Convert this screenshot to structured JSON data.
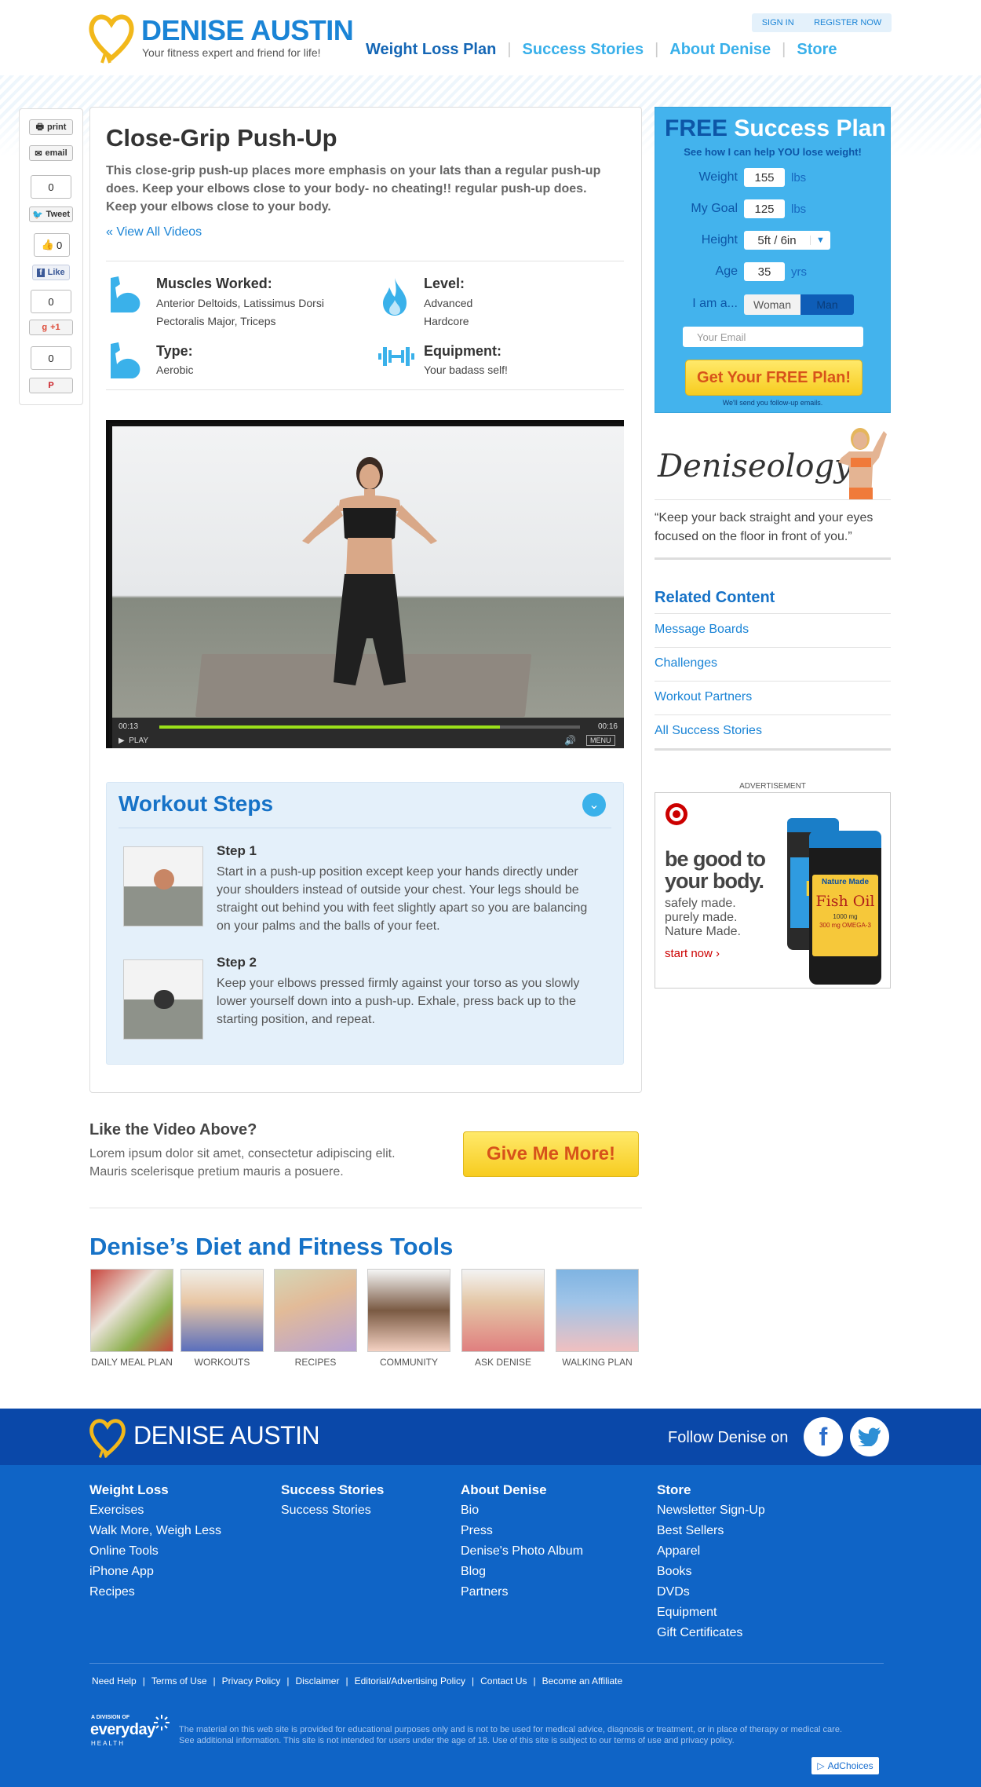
{
  "header": {
    "brand": "DENISE AUSTIN",
    "tagline": "Your fitness expert and friend for life!",
    "sign_in": "SIGN IN",
    "register": "REGISTER NOW",
    "nav": [
      "Weight Loss Plan",
      "Success Stories",
      "About Denise",
      "Store"
    ]
  },
  "share": {
    "print": "print",
    "email": "email",
    "tweet_count": "0",
    "tweet": "Tweet",
    "like_count": "0",
    "like": "Like",
    "gplus_count": "0",
    "gplus": "+1",
    "pin_count": "0"
  },
  "article": {
    "title": "Close-Grip Push-Up",
    "description": "This close-grip push-up places more emphasis on your lats than a regular push-up does. Keep your elbows close to your body- no cheating!!  regular push-up does. Keep your elbows close to your body.",
    "view_all": "« View All Videos",
    "muscles_label": "Muscles Worked:",
    "muscles_line1": "Anterior Deltoids, Latissimus Dorsi",
    "muscles_line2": "Pectoralis Major, Triceps",
    "level_label": "Level:",
    "level_line1": "Advanced",
    "level_line2": "Hardcore",
    "type_label": "Type:",
    "type_value": "Aerobic",
    "equipment_label": "Equipment:",
    "equipment_value": "Your badass self!"
  },
  "video": {
    "time_elapsed": "00:13",
    "time_total": "00:16",
    "progress": 0.81,
    "play": "PLAY",
    "menu": "MENU"
  },
  "steps": {
    "title": "Workout Steps",
    "items": [
      {
        "title": "Step 1",
        "text": "Start in a push-up position except keep your hands directly under your shoulders instead of outside your chest. Your legs should be straight out behind you with feet slightly apart so you are balancing on your palms and the balls of your feet."
      },
      {
        "title": "Step 2",
        "text": "Keep your elbows pressed firmly against your torso as you slowly lower yourself down into a push-up. Exhale, press back up to the starting position, and repeat."
      }
    ]
  },
  "promo": {
    "heading": "Like the Video Above?",
    "text": "Lorem ipsum dolor sit amet, consectetur adipiscing elit. Mauris scelerisque pretium mauris a posuere.",
    "button": "Give Me More!"
  },
  "tools": {
    "title": "Denise’s Diet and Fitness Tools",
    "items": [
      "DAILY MEAL PLAN",
      "WORKOUTS",
      "RECIPES",
      "COMMUNITY",
      "ASK DENISE",
      "WALKING PLAN"
    ]
  },
  "plan": {
    "free": "FREE",
    "title_rest": "Success Plan",
    "subtitle": "See how I can help YOU lose weight!",
    "weight_label": "Weight",
    "weight_value": "155",
    "goal_label": "My Goal",
    "goal_value": "125",
    "lbs": "lbs",
    "height_label": "Height",
    "height_value": "5ft / 6in",
    "age_label": "Age",
    "age_value": "35",
    "yrs": "yrs",
    "iam_label": "I am a...",
    "woman": "Woman",
    "man": "Man",
    "email_placeholder": "Your Email",
    "button": "Get Your FREE Plan!",
    "note": "We'll send you follow-up emails."
  },
  "deniseology": {
    "logo_text": "Deniseology",
    "quote": "“Keep your back straight and your eyes focused on the floor in front of you.”"
  },
  "related": {
    "title": "Related Content",
    "items": [
      "Message Boards",
      "Challenges",
      "Workout Partners",
      "All Success Stories"
    ]
  },
  "ad": {
    "label": "ADVERTISEMENT",
    "headline1": "be good to",
    "headline2": "your body.",
    "line1": "safely made.",
    "line2": "purely made.",
    "line3": "Nature Made.",
    "cta": "start now ›",
    "bottle_brand": "Nature Made",
    "bottle_name": "Fish Oil",
    "bottle_strength": "1000 mg",
    "bottle_omega": "300 mg OMEGA-3",
    "bottle2_letter": "D"
  },
  "footer": {
    "brand": "DENISE AUSTIN",
    "follow": "Follow Denise on",
    "columns": [
      {
        "head": "Weight Loss",
        "links": [
          "Exercises",
          "Walk More, Weigh Less",
          "Online Tools",
          "iPhone App",
          "Recipes"
        ]
      },
      {
        "head": "Success Stories",
        "links": [
          "Success Stories"
        ]
      },
      {
        "head": "About Denise",
        "links": [
          "Bio",
          "Press",
          "Denise's Photo Album",
          "Blog",
          "Partners"
        ]
      },
      {
        "head": "Store",
        "links": [
          "Newsletter Sign-Up",
          "Best Sellers",
          "Apparel",
          "Books",
          "DVDs",
          "Equipment",
          "Gift Certificates"
        ]
      }
    ],
    "bottom_links": [
      "Need Help",
      "Terms of Use",
      "Privacy Policy",
      "Disclaimer",
      "Editorial/Advertising Policy",
      "Contact Us",
      "Become an Affiliate"
    ],
    "division": "A DIVISION OF",
    "everyday": "everyday",
    "health": "HEALTH",
    "disclaimer1": "The material on this web site is provided for educational purposes only and is not to be used for medical advice, diagnosis or treatment, or in place of therapy or medical care.",
    "disclaimer2": "See additional information. This site is not intended for users under the age of 18. Use of this site is subject to our terms of use and privacy policy.",
    "adchoices": "AdChoices"
  },
  "colors": {
    "brand_blue": "#1a84d6",
    "dark_blue": "#0d56a7",
    "plan_bg": "#43b3ed",
    "cta_orange": "#d7531a",
    "cta_yellow": "#f7cc20",
    "progress_green": "#9be01a"
  }
}
